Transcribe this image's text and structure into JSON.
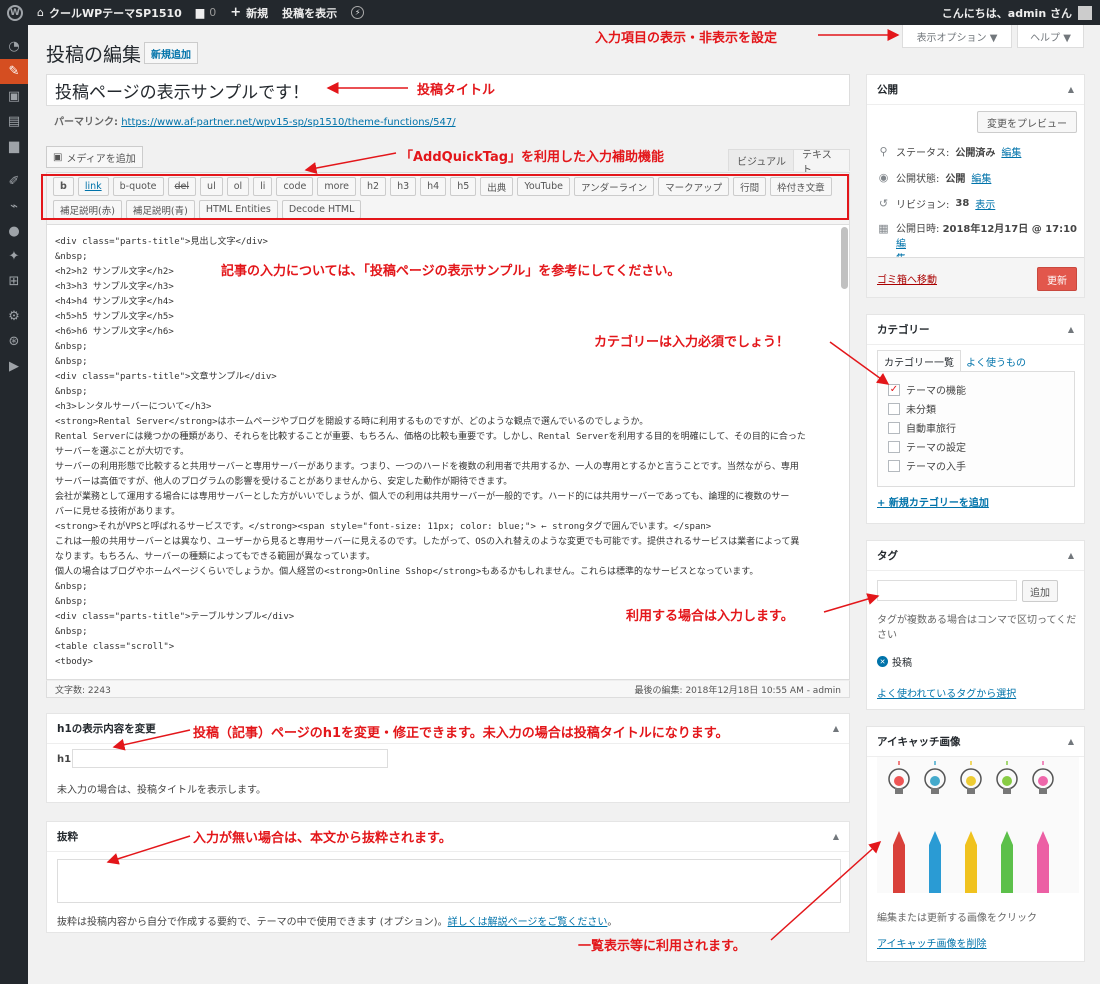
{
  "admin_bar": {
    "site_name": "クールWPテーマSP1510",
    "comments_count": "0",
    "new_label": "新規",
    "view_post": "投稿を表示",
    "greeting": "こんにちは、admin さん"
  },
  "header": {
    "title": "投稿の編集",
    "add_new": "新規追加",
    "screen_options": "表示オプション ▼",
    "help": "ヘルプ ▼"
  },
  "post": {
    "title": "投稿ページの表示サンプルです！",
    "permalink_label": "パーマリンク:",
    "permalink_url": "https://www.af-partner.net/wpv15-sp/sp1510/theme-functions/547/"
  },
  "editor": {
    "media_button": "メディアを追加",
    "tab_visual": "ビジュアル",
    "tab_text": "テキスト",
    "quicktags": [
      "b",
      "link",
      "b-quote",
      "del",
      "ul",
      "ol",
      "li",
      "code",
      "more",
      "h2",
      "h3",
      "h4",
      "h5",
      "出典",
      "YouTube",
      "アンダーライン",
      "マークアップ",
      "行間",
      "枠付き文章",
      "補足説明(赤)",
      "補足説明(青)",
      "HTML Entities",
      "Decode HTML"
    ],
    "code_lines": [
      "<div class=\"parts-title\">見出し文字</div>",
      "&nbsp;",
      "<h2>h2 サンプル文字</h2>",
      "<h3>h3 サンプル文字</h3>",
      "<h4>h4 サンプル文字</h4>",
      "<h5>h5 サンプル文字</h5>",
      "<h6>h6 サンプル文字</h6>",
      "&nbsp;",
      "&nbsp;",
      "<div class=\"parts-title\">文章サンプル</div>",
      "&nbsp;",
      "<h3>レンタルサーバーについて</h3>",
      "<strong>Rental Server</strong>はホームページやブログを開設する時に利用するものですが、どのような観点で選んでいるのでしょうか。",
      "Rental Serverには幾つかの種類があり、それらを比較することが重要、もちろん、価格の比較も重要です。しかし、Rental Serverを利用する目的を明確にして、その目的に合った",
      "サーバーを選ぶことが大切です。",
      "サーバーの利用形態で比較すると共用サーバーと専用サーバーがあります。つまり、一つのハードを複数の利用者で共用するか、一人の専用とするかと言うことです。当然ながら、専用",
      "サーバーは高価ですが、他人のプログラムの影響を受けることがありませんから、安定した動作が期待できます。",
      "会社が業務として運用する場合には専用サーバーとした方がいいでしょうが、個人での利用は共用サーバーが一般的です。ハード的には共用サーバーであっても、論理的に複数のサー",
      "バーに見せる技術があります。",
      "<strong>それがVPSと呼ばれるサービスです。</strong><span style=\"font-size: 11px; color: blue;\"> ← strongタグで囲んでいます。</span>",
      "これは一般の共用サーバーとは異なり、ユーザーから見ると専用サーバーに見えるのです。したがって、OSの入れ替えのような変更でも可能です。提供されるサービスは業者によって異",
      "なります。もちろん、サーバーの種類によってもできる範囲が異なっています。",
      "個人の場合はブログやホームページくらいでしょうか。個人経営の<strong>Online Sshop</strong>もあるかもしれません。これらは標準的なサービスとなっています。",
      "",
      "&nbsp;",
      "&nbsp;",
      "<div class=\"parts-title\">テーブルサンプル</div>",
      "&nbsp;",
      "<table class=\"scroll\">",
      "<tbody>"
    ],
    "word_count": "文字数: 2243",
    "last_edit": "最後の編集: 2018年12月18日 10:55 AM - admin"
  },
  "h1_box": {
    "title": "h1の表示内容を変更",
    "label": "h1",
    "note": "未入力の場合は、投稿タイトルを表示します。"
  },
  "excerpt_box": {
    "title": "抜粋",
    "note": "抜粋は投稿内容から自分で作成する要約で、テーマの中で使用できます (オプション)。",
    "note_link": "詳しくは解説ページをご覧ください",
    "note_end": "。"
  },
  "publish_box": {
    "title": "公開",
    "preview": "変更をプレビュー",
    "status_label": "ステータス:",
    "status_value": "公開済み",
    "visibility_label": "公開状態:",
    "visibility_value": "公開",
    "revisions_label": "リビジョン:",
    "revisions_value": "38",
    "revisions_link": "表示",
    "date_label": "公開日時:",
    "date_value": "2018年12月17日 @ 17:10",
    "edit": "編集",
    "edit_wrap_1": "編",
    "edit_wrap_2": "集",
    "trash": "ゴミ箱へ移動",
    "update": "更新"
  },
  "category_box": {
    "title": "カテゴリー",
    "tab_all": "カテゴリー一覧",
    "tab_popular": "よく使うもの",
    "items": [
      {
        "label": "テーマの機能",
        "checked": "✓"
      },
      {
        "label": "未分類",
        "checked": ""
      },
      {
        "label": "自動車旅行",
        "checked": ""
      },
      {
        "label": "テーマの設定",
        "checked": ""
      },
      {
        "label": "テーマの入手",
        "checked": ""
      }
    ],
    "add_new": "+ 新規カテゴリーを追加"
  },
  "tag_box": {
    "title": "タグ",
    "add": "追加",
    "hint": "タグが複数ある場合はコンマで区切ってください",
    "tag": "投稿",
    "popular_link": "よく使われているタグから選択"
  },
  "eyecatch_box": {
    "title": "アイキャッチ画像",
    "hint": "編集または更新する画像をクリック",
    "remove": "アイキャッチ画像を削除"
  },
  "annotations": {
    "screen_options": "入力項目の表示・非表示を設定",
    "post_title": "投稿タイトル",
    "quicktag": "「AddQuickTag」を利用した入力補助機能",
    "content": "記事の入力については、「投稿ページの表示サンプル」を参考にしてください。",
    "category": "カテゴリーは入力必須でしょう！",
    "tag": "利用する場合は入力します。",
    "h1": "投稿（記事）ページのh1を変更・修正できます。未入力の場合は投稿タイトルになります。",
    "excerpt": "入力が無い場合は、本文から抜粋されます。",
    "eyecatch": "一覧表示等に利用されます。"
  },
  "colors": {
    "accent": "#e3161a",
    "link": "#0073aa",
    "update_button": "#e2574c",
    "menu_active": "#d54e21"
  }
}
